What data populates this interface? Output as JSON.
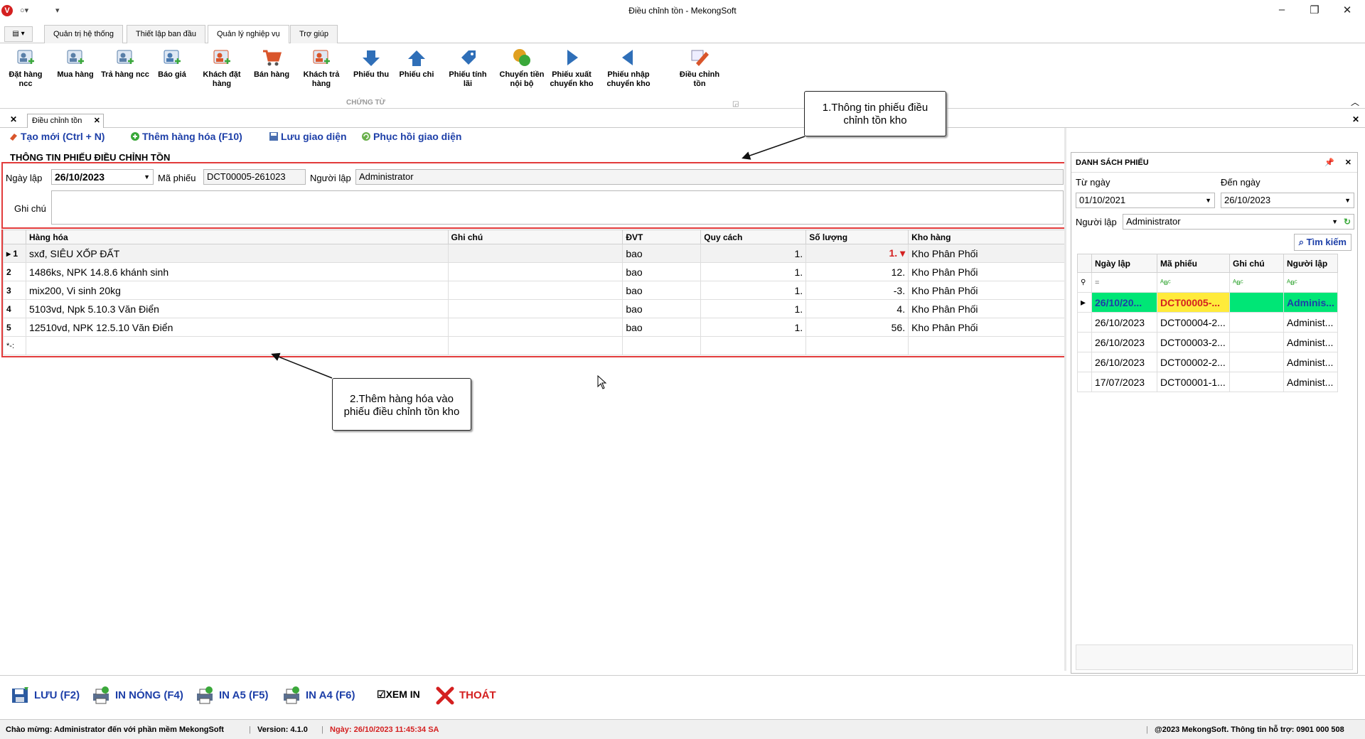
{
  "window": {
    "title": "Điều chỉnh tồn - MekongSoft",
    "logo_letter": "V"
  },
  "ribbon_tabs": [
    {
      "label": "Quản trị hệ thống"
    },
    {
      "label": "Thiết lập ban đầu"
    },
    {
      "label": "Quản lý nghiệp vụ"
    },
    {
      "label": "Trợ giúp"
    }
  ],
  "ribbon_buttons": [
    {
      "label": "Đặt hàng ncc",
      "icon": "order-supplier-icon",
      "color": "#5a7fa8"
    },
    {
      "label": "Mua hàng",
      "icon": "purchase-icon",
      "color": "#5a7fa8"
    },
    {
      "label": "Trả hàng ncc",
      "icon": "return-supplier-icon",
      "color": "#5a7fa8"
    },
    {
      "label": "Báo giá",
      "icon": "quotation-icon",
      "color": "#4a7ab0"
    },
    {
      "label": "Khách đặt hàng",
      "icon": "customer-order-icon",
      "color": "#d9552b"
    },
    {
      "label": "Bán hàng",
      "icon": "cart-icon",
      "color": "#d9552b"
    },
    {
      "label": "Khách trả hàng",
      "icon": "customer-return-icon",
      "color": "#d9552b"
    },
    {
      "label": "Phiếu thu",
      "icon": "arrow-down-icon",
      "color": "#2f6fb8"
    },
    {
      "label": "Phiếu chi",
      "icon": "arrow-up-icon",
      "color": "#2f6fb8"
    },
    {
      "label": "Phiếu tính lãi",
      "icon": "interest-tag-icon",
      "color": "#2f6fb8"
    },
    {
      "label": "Chuyển tiền nội bộ",
      "icon": "coins-icon",
      "color": "#e0a020"
    },
    {
      "label": "Phiếu xuất chuyển kho",
      "icon": "arrow-right-icon",
      "color": "#2f6fb8"
    },
    {
      "label": "Phiếu nhập chuyển kho",
      "icon": "arrow-left-icon",
      "color": "#2f6fb8"
    },
    {
      "label": "Điều chỉnh tồn",
      "icon": "edit-pencil-icon",
      "color": "#d9552b"
    }
  ],
  "ribbon_group_label": "CHỨNG TỪ",
  "doc_tab": {
    "label": "Điều chỉnh tồn"
  },
  "toolbar": {
    "new_label": "Tạo mới (Ctrl + N)",
    "add_goods_label": "Thêm hàng hóa (F10)",
    "save_layout_label": "Lưu giao diện",
    "restore_layout_label": "Phục hồi giao diện"
  },
  "section_title": "THÔNG TIN PHIẾU ĐIỀU CHỈNH TỒN",
  "form": {
    "date_label": "Ngày lập",
    "date_value": "26/10/2023",
    "code_label": "Mã phiếu",
    "code_value": "DCT00005-261023",
    "creator_label": "Người lập",
    "creator_value": "Administrator",
    "note_label": "Ghi chú",
    "note_value": ""
  },
  "grid": {
    "columns": [
      "Hàng hóa",
      "Ghi chú",
      "ĐVT",
      "Quy cách",
      "Số lượng",
      "Kho hàng"
    ],
    "rows": [
      {
        "no": "1",
        "item": "sxđ, SIÊU XỐP ĐẤT",
        "note": "",
        "unit": "bao",
        "spec": "1.",
        "qty": "1.",
        "warehouse": "Kho Phân Phối"
      },
      {
        "no": "2",
        "item": "1486ks, NPK 14.8.6 khánh sinh",
        "note": "",
        "unit": "bao",
        "spec": "1.",
        "qty": "12.",
        "warehouse": "Kho Phân Phối"
      },
      {
        "no": "3",
        "item": "mix200, Vi sinh 20kg",
        "note": "",
        "unit": "bao",
        "spec": "1.",
        "qty": "-3.",
        "warehouse": "Kho Phân Phối"
      },
      {
        "no": "4",
        "item": "5103vd, Npk 5.10.3 Văn Điển",
        "note": "",
        "unit": "bao",
        "spec": "1.",
        "qty": "4.",
        "warehouse": "Kho Phân Phối"
      },
      {
        "no": "5",
        "item": "12510vd, NPK 12.5.10 Văn Điển",
        "note": "",
        "unit": "bao",
        "spec": "1.",
        "qty": "56.",
        "warehouse": "Kho Phân Phối"
      }
    ],
    "new_row_marker": "*-:"
  },
  "callouts": {
    "c1": "1.Thông tin phiếu điều chỉnh tồn kho",
    "c2": "2.Thêm hàng hóa vào phiếu điều chỉnh tồn kho"
  },
  "right_panel": {
    "title": "DANH SÁCH PHIẾU",
    "from_label": "Từ ngày",
    "from_value": "01/10/2021",
    "to_label": "Đến ngày",
    "to_value": "26/10/2023",
    "creator_label": "Người lập",
    "creator_value": "Administrator",
    "search_label": "Tìm kiếm",
    "columns": [
      "Ngày lập",
      "Mã phiếu",
      "Ghi chú",
      "Người lập"
    ],
    "filter_symbols": [
      "=",
      "ᴬᴃᶜ",
      "ᴬᴃᶜ",
      "ᴬᴃᶜ"
    ],
    "rows": [
      {
        "date": "26/10/20...",
        "code": "DCT00005-...",
        "note": "",
        "creator": "Adminis..."
      },
      {
        "date": "26/10/2023",
        "code": "DCT00004-2...",
        "note": "",
        "creator": "Administ..."
      },
      {
        "date": "26/10/2023",
        "code": "DCT00003-2...",
        "note": "",
        "creator": "Administ..."
      },
      {
        "date": "26/10/2023",
        "code": "DCT00002-2...",
        "note": "",
        "creator": "Administ..."
      },
      {
        "date": "17/07/2023",
        "code": "DCT00001-1...",
        "note": "",
        "creator": "Administ..."
      }
    ]
  },
  "bottom_buttons": {
    "save": "LƯU (F2)",
    "print_hot": "IN NÓNG (F4)",
    "print_a5": "IN A5 (F5)",
    "print_a4": "IN A4 (F6)",
    "preview": "XEM IN",
    "exit": "THOÁT"
  },
  "status": {
    "welcome": "Chào mừng: Administrator đến với phần mềm MekongSoft",
    "version": "Version: 4.1.0",
    "date": "Ngày: 26/10/2023 11:45:34 SA",
    "copyright": "@2023 MekongSoft. Thông tin hỗ trợ: 0901 000 508"
  }
}
